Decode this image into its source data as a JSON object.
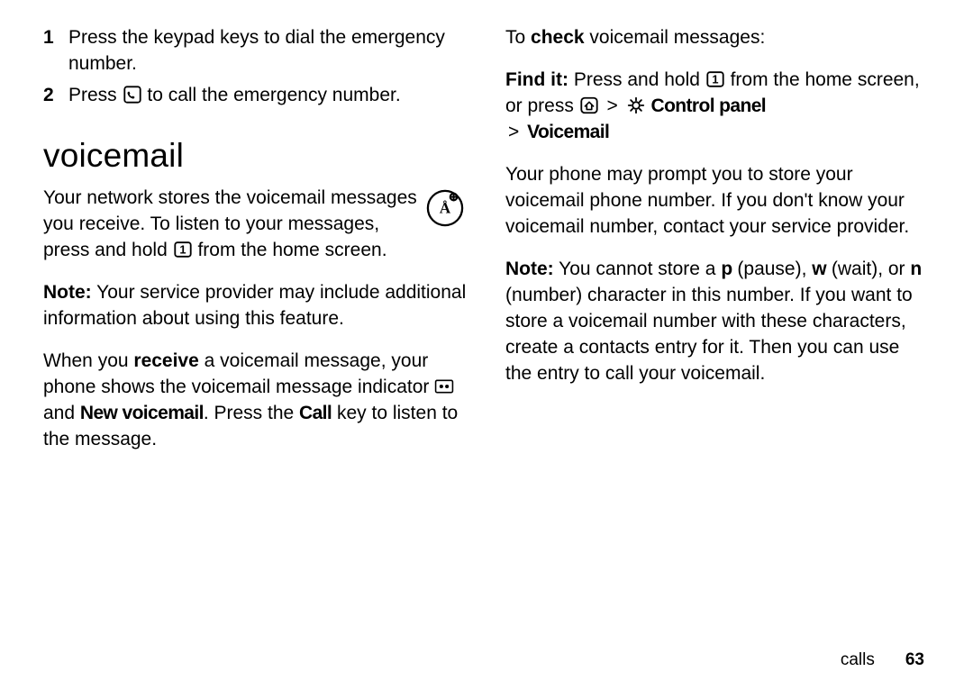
{
  "left": {
    "steps": [
      {
        "num": "1",
        "text_a": "Press the keypad keys to dial the emergency number."
      },
      {
        "num": "2",
        "text_a": "Press ",
        "text_b": " to call the emergency number."
      }
    ],
    "section_title": "voicemail",
    "p1_a": "Your network stores the voicemail messages you receive. To listen to your messages, press and hold ",
    "p1_b": " from the home screen.",
    "p2_label": "Note:",
    "p2": " Your service provider may include additional information about using this feature.",
    "p3_a": "When you ",
    "p3_receive": "receive",
    "p3_b": " a voicemail message, your phone shows the voicemail message indicator ",
    "p3_c": " and ",
    "p3_newvm": "New voicemail",
    "p3_d": ". Press the ",
    "p3_call": "Call",
    "p3_e": " key to listen to the message."
  },
  "right": {
    "p1_a": "To ",
    "p1_check": "check",
    "p1_b": " voicemail messages:",
    "p2_label": "Find it:",
    "p2_a": " Press and hold ",
    "p2_b": " from the home screen, or press ",
    "p2_c": " ",
    "gt": ">",
    "p2_d": " ",
    "p2_cp": "Control panel",
    "p2_e": " ",
    "p2_vm": "Voicemail",
    "p3": "Your phone may prompt you to store your voicemail phone number. If you don't know your voicemail number, contact your service provider.",
    "p4_label": "Note:",
    "p4_a": " You cannot store a ",
    "p4_p": "p",
    "p4_b": " (pause), ",
    "p4_w": "w",
    "p4_c": " (wait), or ",
    "p4_n": "n",
    "p4_d": " (number) character in this number. If you want to store a voicemail number with these characters, create a contacts entry for it. Then you can use the entry to call your voicemail."
  },
  "footer": {
    "section": "calls",
    "page": "63"
  }
}
